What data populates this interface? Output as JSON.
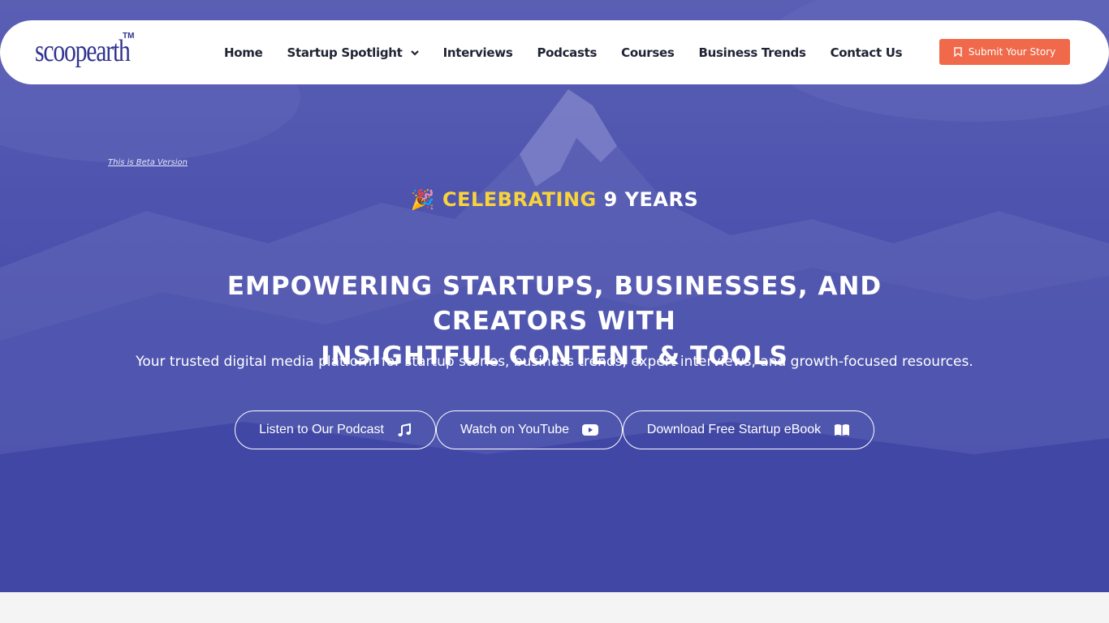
{
  "brand": {
    "logo_text": "scoopearth",
    "trademark": "TM"
  },
  "nav": {
    "items": [
      {
        "label": "Home"
      },
      {
        "label": "Startup Spotlight",
        "has_dropdown": true
      },
      {
        "label": "Interviews"
      },
      {
        "label": "Podcasts"
      },
      {
        "label": "Courses"
      },
      {
        "label": "Business Trends"
      },
      {
        "label": "Contact Us"
      }
    ],
    "submit_label": "Submit Your Story"
  },
  "hero": {
    "beta_note": "This is Beta Version",
    "celebrate_emoji": "🎉",
    "celebrate_highlight": "CELEBRATING",
    "celebrate_rest": "9 YEARS",
    "headline_line1": "EMPOWERING STARTUPS, BUSINESSES, AND CREATORS WITH",
    "headline_line2": "INSIGHTFUL CONTENT & TOOLS",
    "subline": "Your trusted digital media platform for startup stories, business trends, expert interviews, and growth-focused resources.",
    "ctas": [
      {
        "label": "Listen to Our Podcast",
        "icon": "music-icon"
      },
      {
        "label": "Watch on YouTube",
        "icon": "youtube-icon"
      },
      {
        "label": "Download Free Startup eBook",
        "icon": "book-icon"
      }
    ]
  },
  "colors": {
    "hero_overlay": "#3d44a3",
    "accent": "#f0694a",
    "highlight": "#f8d43a",
    "logo": "#30338f"
  }
}
